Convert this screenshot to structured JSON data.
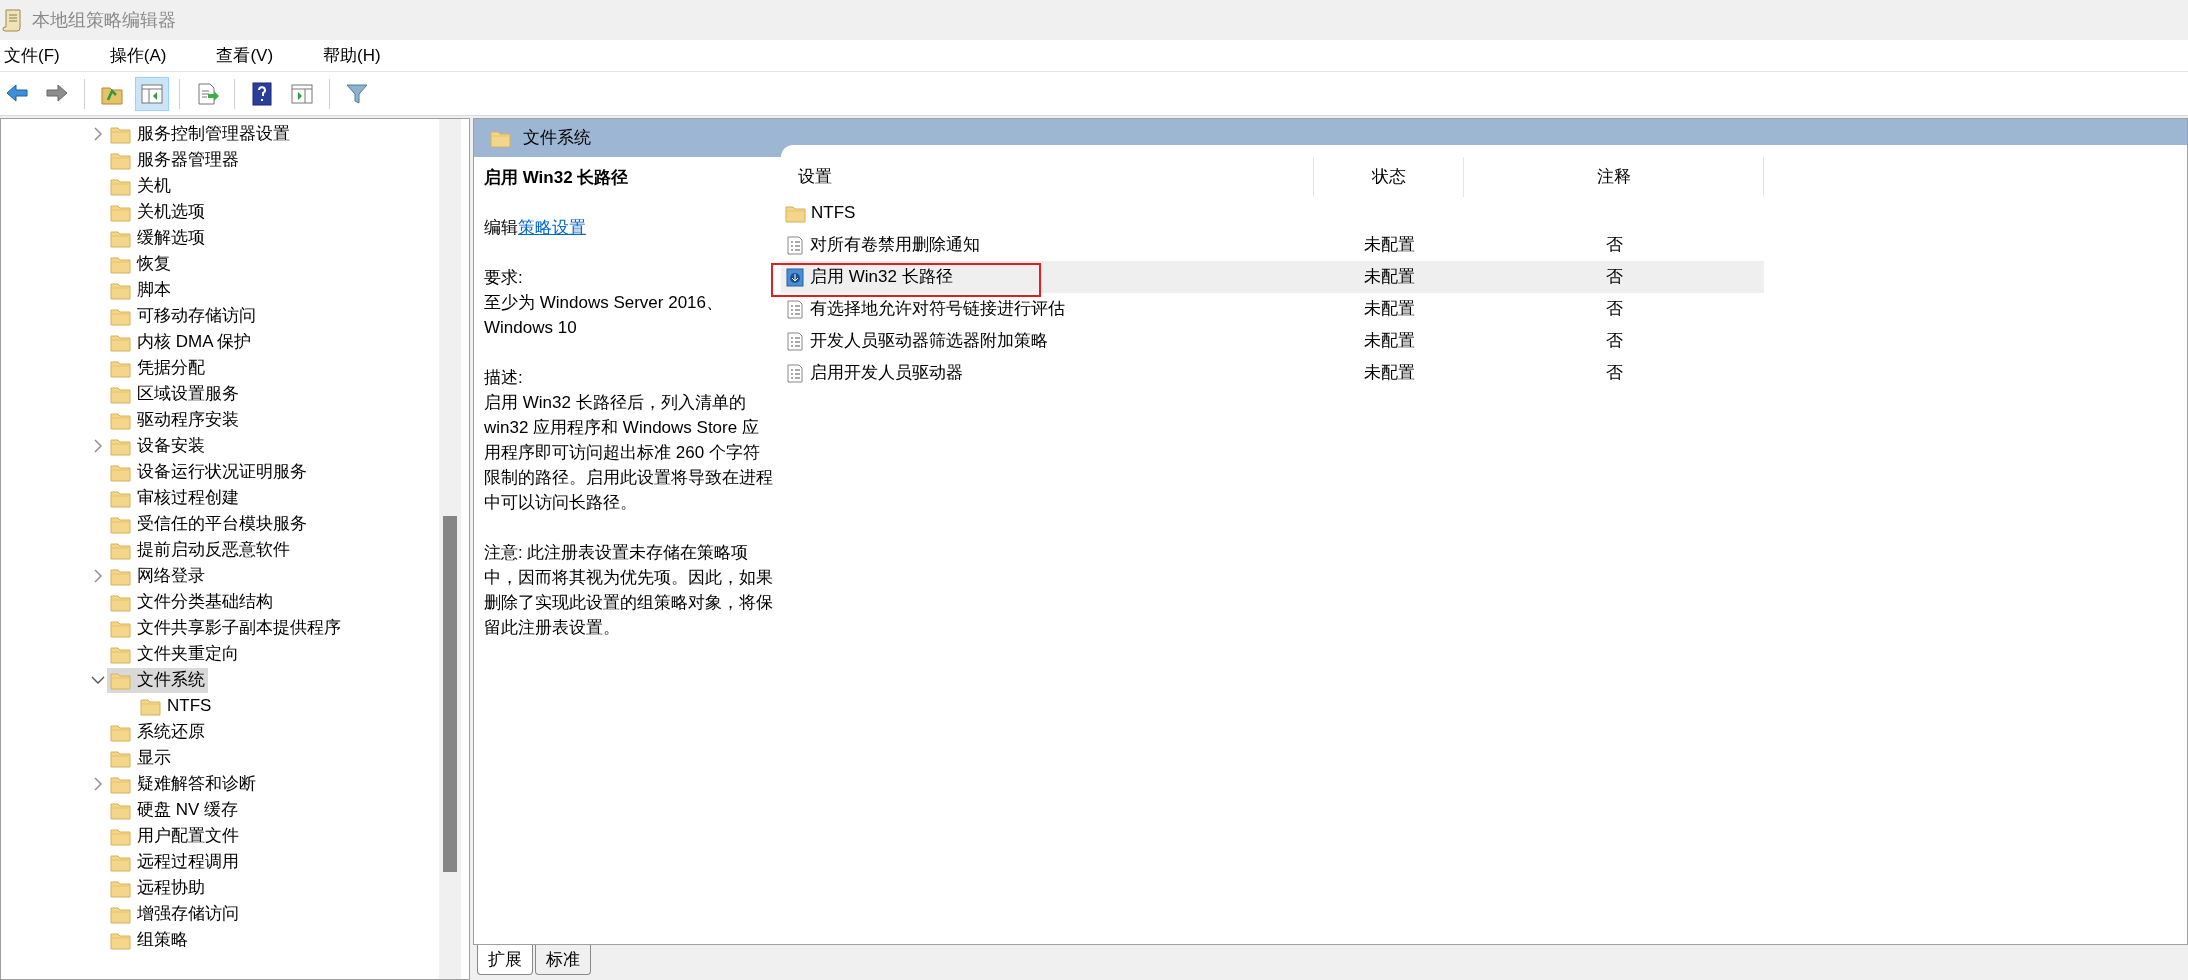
{
  "window": {
    "title": "本地组策略编辑器"
  },
  "menu": [
    "文件(F)",
    "操作(A)",
    "查看(V)",
    "帮助(H)"
  ],
  "toolbar": [
    {
      "kind": "back",
      "pressed": false
    },
    {
      "kind": "forward",
      "pressed": false
    },
    {
      "kind": "separator"
    },
    {
      "kind": "up",
      "pressed": false
    },
    {
      "kind": "tree",
      "pressed": true
    },
    {
      "kind": "separator"
    },
    {
      "kind": "export",
      "pressed": false
    },
    {
      "kind": "separator"
    },
    {
      "kind": "help",
      "pressed": false
    },
    {
      "kind": "pane",
      "pressed": false
    },
    {
      "kind": "separator"
    },
    {
      "kind": "filter",
      "pressed": false
    }
  ],
  "tree": [
    {
      "label": "服务控制管理器设置",
      "expanded": false,
      "selected": false
    },
    {
      "label": "服务器管理器",
      "selected": false
    },
    {
      "label": "关机",
      "selected": false
    },
    {
      "label": "关机选项",
      "selected": false
    },
    {
      "label": "缓解选项",
      "selected": false
    },
    {
      "label": "恢复",
      "selected": false
    },
    {
      "label": "脚本",
      "selected": false
    },
    {
      "label": "可移动存储访问",
      "selected": false
    },
    {
      "label": "内核 DMA 保护",
      "selected": false
    },
    {
      "label": "凭据分配",
      "selected": false
    },
    {
      "label": "区域设置服务",
      "selected": false
    },
    {
      "label": "驱动程序安装",
      "selected": false
    },
    {
      "label": "设备安装",
      "expanded": false,
      "selected": false
    },
    {
      "label": "设备运行状况证明服务",
      "selected": false
    },
    {
      "label": "审核过程创建",
      "selected": false
    },
    {
      "label": "受信任的平台模块服务",
      "selected": false
    },
    {
      "label": "提前启动反恶意软件",
      "selected": false
    },
    {
      "label": "网络登录",
      "expanded": false,
      "selected": false
    },
    {
      "label": "文件分类基础结构",
      "selected": false
    },
    {
      "label": "文件共享影子副本提供程序",
      "selected": false
    },
    {
      "label": "文件夹重定向",
      "selected": false
    },
    {
      "label": "文件系统",
      "expanded": true,
      "selected": true,
      "children": [
        {
          "label": "NTFS",
          "selected": false
        }
      ]
    },
    {
      "label": "系统还原",
      "selected": false
    },
    {
      "label": "显示",
      "selected": false
    },
    {
      "label": "疑难解答和诊断",
      "expanded": false,
      "selected": false
    },
    {
      "label": "硬盘 NV 缓存",
      "selected": false
    },
    {
      "label": "用户配置文件",
      "selected": false
    },
    {
      "label": "远程过程调用",
      "selected": false
    },
    {
      "label": "远程协助",
      "selected": false
    },
    {
      "label": "增强存储访问",
      "selected": false
    },
    {
      "label": "组策略",
      "selected": false
    }
  ],
  "header": {
    "title": "文件系统"
  },
  "description": {
    "title": "启用 Win32 长路径",
    "edit_prefix": "编辑",
    "edit_link": "策略设置",
    "requirements_label": "要求:",
    "requirements": "至少为 Windows Server 2016、Windows 10",
    "description_label": "描述:",
    "description": "启用 Win32 长路径后，列入清单的 win32 应用程序和 Windows Store 应用程序即可访问超出标准 260 个字符限制的路径。启用此设置将导致在进程中可以访问长路径。",
    "note": "注意: 此注册表设置未存储在策略项中，因而将其视为优先项。因此，如果删除了实现此设置的组策略对象，将保留此注册表设置。"
  },
  "table": {
    "columns": [
      "设置",
      "状态",
      "注释"
    ],
    "rows": [
      {
        "kind": "folder",
        "name": "NTFS",
        "selected": false
      },
      {
        "kind": "policy",
        "name": "对所有卷禁用删除通知",
        "state": "未配置",
        "comment": "否",
        "selected": false
      },
      {
        "kind": "policy",
        "name": "启用 Win32 长路径",
        "state": "未配置",
        "comment": "否",
        "selected": true
      },
      {
        "kind": "policy",
        "name": "有选择地允许对符号链接进行评估",
        "state": "未配置",
        "comment": "否",
        "selected": false
      },
      {
        "kind": "policy",
        "name": "开发人员驱动器筛选器附加策略",
        "state": "未配置",
        "comment": "否",
        "selected": false
      },
      {
        "kind": "policy",
        "name": "启用开发人员驱动器",
        "state": "未配置",
        "comment": "否",
        "selected": false
      }
    ]
  },
  "tabs": [
    {
      "label": "扩展",
      "selected": true
    },
    {
      "label": "标准",
      "selected": false
    }
  ]
}
